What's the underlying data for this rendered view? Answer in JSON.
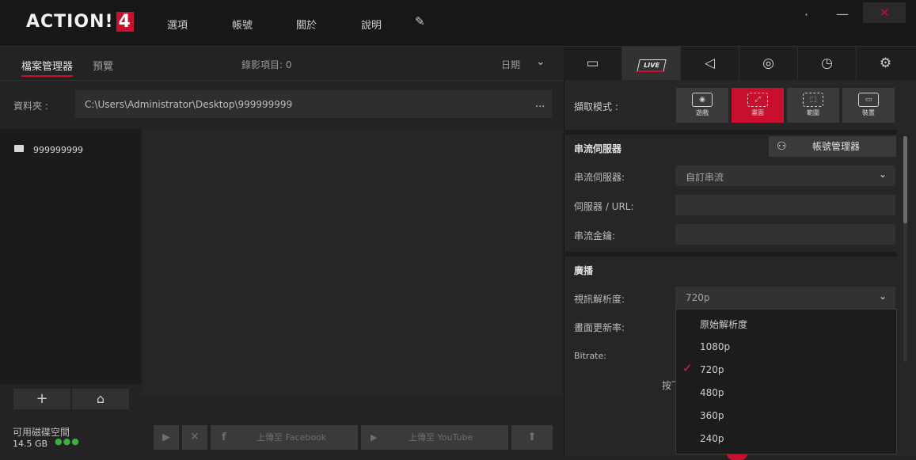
{
  "app": {
    "logo_text": "ACTION!",
    "logo_version": "4",
    "menu": [
      "選項",
      "帳號",
      "關於",
      "說明"
    ],
    "brush_icon": "✎",
    "window_buttons": {
      "restore": "·",
      "minimize": "—",
      "close": "✕"
    }
  },
  "left": {
    "tabs": {
      "files": "檔案管理器",
      "preview": "預覽"
    },
    "record_count": "錄影項目: 0",
    "sort": "日期",
    "folder_label": "資料夾 :",
    "folder_path": "C:\\Users\\Administrator\\Desktop\\999999999",
    "folder_browse": "...",
    "tree_item": "999999999",
    "tree_buttons": {
      "add": "+",
      "folder": "⌂"
    },
    "disk_label": "可用磁碟空間",
    "disk_size": "14.5 GB",
    "disk_dots": "●●●",
    "actions": {
      "play": "▶",
      "delete": "✕",
      "fb_icon": "f",
      "facebook": "上傳至 Facebook",
      "yt_icon": "▶",
      "youtube": "上傳至 YouTube",
      "upload": "⬆"
    }
  },
  "right": {
    "tabs": {
      "video": "▭",
      "live": "LIVE",
      "audio": "◁",
      "screenshot": "◎",
      "timer": "◷",
      "settings": "⚙"
    },
    "capture_mode_label": "擷取模式 :",
    "capture_modes": [
      {
        "glyph": "◉",
        "label": "遊戲"
      },
      {
        "glyph": "⤢",
        "label": "畫面"
      },
      {
        "glyph": "⬚",
        "label": "範圍"
      },
      {
        "glyph": "▭",
        "label": "裝置"
      }
    ],
    "stream_section": "串流伺服器",
    "account_button": "帳號管理器",
    "account_icon": "⚇",
    "stream_server_label": "串流伺服器:",
    "stream_server_value": "自訂串流",
    "server_url_label": "伺服器 / URL:",
    "stream_key_label": "串流金鑰:",
    "broadcast_section": "廣播",
    "resolution_label": "視訊解析度:",
    "resolution_value": "720p",
    "framerate_label": "畫面更新率:",
    "bitrate_label": "Bitrate:",
    "hint_text": "按下",
    "dropdown_options": [
      "原始解析度",
      "1080p",
      "720p",
      "480p",
      "360p",
      "240p"
    ],
    "dropdown_selected": "720p"
  },
  "colors": {
    "accent": "#c8102e",
    "disk_ok": "#3fae3f"
  }
}
